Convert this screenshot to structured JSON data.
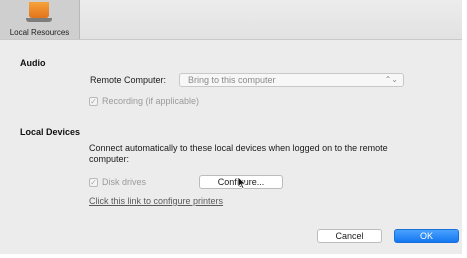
{
  "toolbar": {
    "tab_label": "Local Resources"
  },
  "audio": {
    "title": "Audio",
    "remote_computer_label": "Remote Computer:",
    "remote_computer_value": "Bring to this computer",
    "recording_label": "Recording (if applicable)",
    "recording_checked": true
  },
  "local_devices": {
    "title": "Local Devices",
    "description": "Connect automatically to these local devices when logged on to the remote computer:",
    "disk_drives_label": "Disk drives",
    "disk_drives_checked": true,
    "configure_button": "Configure...",
    "printers_link": "Click this link to configure printers"
  },
  "footer": {
    "cancel_button": "Cancel",
    "ok_button": "OK"
  },
  "colors": {
    "accent": "#1577f0",
    "window_bg": "#ececec"
  }
}
